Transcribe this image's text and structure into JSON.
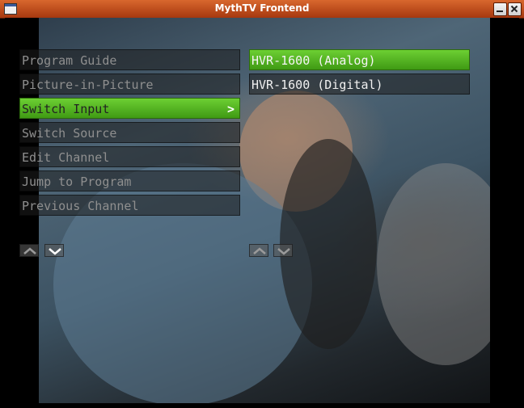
{
  "window": {
    "title": "MythTV Frontend"
  },
  "menu": {
    "items": [
      {
        "label": "Program Guide"
      },
      {
        "label": "Picture-in-Picture"
      },
      {
        "label": "Switch Input",
        "arrow": ">"
      },
      {
        "label": "Switch Source"
      },
      {
        "label": "Edit Channel"
      },
      {
        "label": "Jump to Program"
      },
      {
        "label": "Previous Channel"
      }
    ],
    "selected": "Switch Input"
  },
  "submenu": {
    "items": [
      {
        "label": "HVR-1600 (Analog)"
      },
      {
        "label": "HVR-1600 (Digital)"
      }
    ],
    "selected": "HVR-1600 (Analog)"
  },
  "icons": {
    "scroll_up": "up-arrow-icon",
    "scroll_down": "down-arrow-icon",
    "minimize": "minimize-icon",
    "close": "close-icon"
  },
  "colors": {
    "title_bar": "#c24a1a",
    "selected": "#5cbf2a"
  }
}
